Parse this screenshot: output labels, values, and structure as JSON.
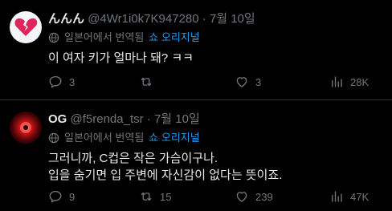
{
  "tweets": [
    {
      "name": "んんん",
      "handle": "@4Wr1i0k7K947280",
      "dot": "·",
      "date": "7월 10일",
      "translated_label": "일본어에서 번역됨",
      "source_link": "쇼 오리지널",
      "text_lines": [
        "이 여자 키가 얼마나 돼? ㅋㅋ"
      ],
      "replies": "3",
      "retweets": "",
      "likes": "3",
      "views": "28K",
      "avatar_icon": "broken-heart-icon",
      "avatar_color": "#e0245e"
    },
    {
      "name": "OG",
      "handle": "@f5renda_tsr",
      "dot": "·",
      "date": "7월 10일",
      "translated_label": "일본어에서 번역됨",
      "source_link": "쇼 오리지널",
      "text_lines": [
        "그러니까, C컵은 작은 가슴이구나.",
        "입을 숨기면 입 주변에 자신감이 없다는 뜻이죠."
      ],
      "replies": "9",
      "retweets": "15",
      "likes": "239",
      "views": "47K",
      "avatar_icon": "red-eye-icon",
      "avatar_color": "#c8151a"
    }
  ],
  "colors": {
    "background": "#000000",
    "text": "#e7e9ea",
    "muted": "#71767b",
    "link": "#1d9bf0",
    "divider": "#2f3336"
  }
}
